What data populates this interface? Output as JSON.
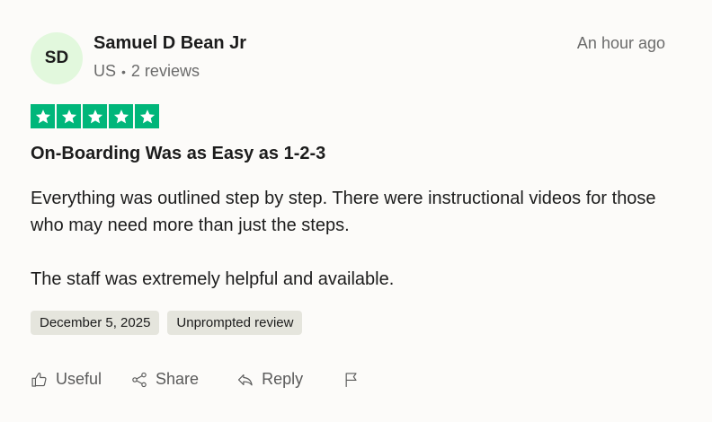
{
  "reviewer": {
    "initials": "SD",
    "name": "Samuel D Bean Jr",
    "country": "US",
    "separator": "•",
    "review_count": "2 reviews",
    "avatar_color": "#e2f8dd"
  },
  "timestamp": "An hour ago",
  "rating": {
    "stars": 5,
    "max": 5,
    "star_color": "#00b67a"
  },
  "review": {
    "title": "On-Boarding Was as Easy as 1-2-3",
    "paragraphs": [
      "Everything was outlined step by step. There were instructional videos for those who may need more than just the steps.",
      "The staff was extremely helpful and available."
    ]
  },
  "tags": {
    "date": "December 5, 2025",
    "type": "Unprompted review"
  },
  "actions": {
    "useful_label": "Useful",
    "share_label": "Share",
    "reply_label": "Reply",
    "useful_icon": "thumbs-up-icon",
    "share_icon": "share-icon",
    "reply_icon": "reply-icon",
    "flag_icon": "flag-icon"
  }
}
